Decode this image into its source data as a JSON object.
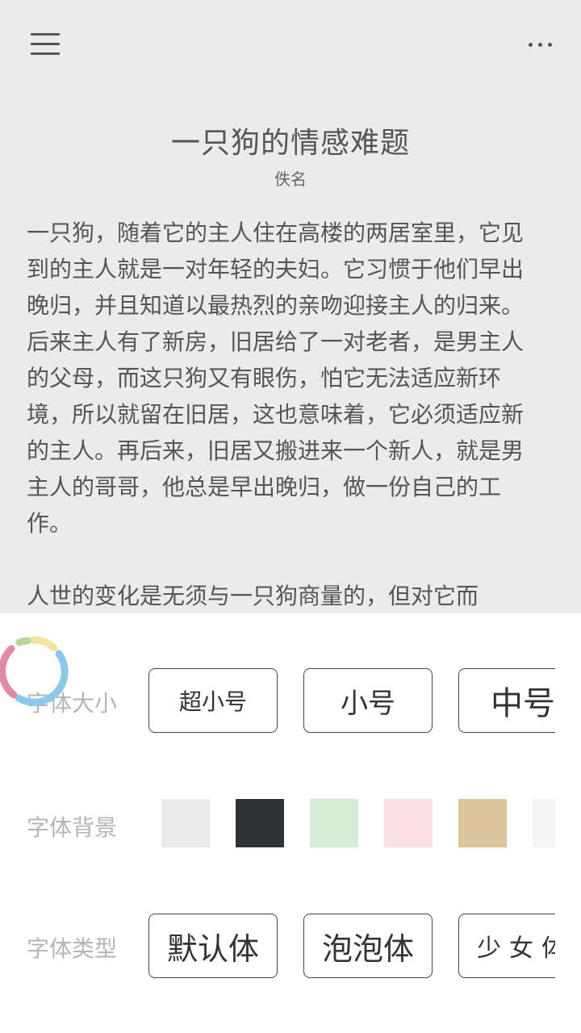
{
  "book": {
    "title": "一只狗的情感难题",
    "author": "佚名",
    "paragraphs": [
      "一只狗，随着它的主人住在高楼的两居室里，它见到的主人就是一对年轻的夫妇。它习惯于他们早出晚归，并且知道以最热烈的亲吻迎接主人的归来。后来主人有了新房，旧居给了一对老者，是男主人的父母，而这只狗又有眼伤，怕它无法适应新环境，所以就留在旧居，这也意味着，它必须适应新的主人。再后来，旧居又搬进来一个新人，就是男主人的哥哥，他总是早出晚归，做一份自己的工作。",
      "人世的变化是无须与一只狗商量的，但对它而"
    ]
  },
  "settings": {
    "font_size": {
      "label": "字体大小",
      "options": [
        "超小号",
        "小号",
        "中号"
      ]
    },
    "font_background": {
      "label": "字体背景",
      "colors": [
        "#ebebeb",
        "#2f3336",
        "#d5edd5",
        "#f9dfe0",
        "#dbc59a",
        "#f5f5f5"
      ]
    },
    "font_type": {
      "label": "字体类型",
      "options": [
        "默认体",
        "泡泡体",
        "少女体"
      ]
    }
  },
  "colors": {
    "reader_bg": "#ebebeb",
    "text": "#555555",
    "label": "#b5b5b5",
    "border": "#444444"
  },
  "icons": {
    "menu": "hamburger-menu-icon",
    "more": "more-dots-icon",
    "loading": "loading-ring-icon"
  }
}
